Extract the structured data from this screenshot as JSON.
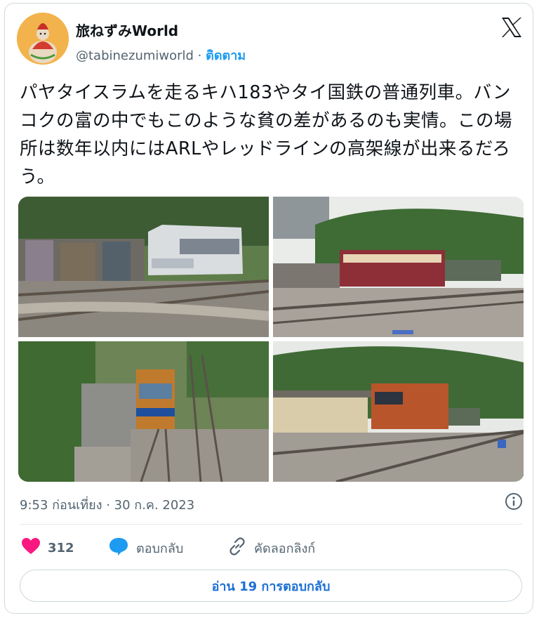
{
  "user": {
    "display_name": "旅ねずみWorld",
    "handle": "@tabinezumiworld",
    "separator": " · ",
    "follow_label": "ติดตาม"
  },
  "tweet": {
    "text": "パヤタイスラムを走るキハ183やタイ国鉄の普通列車。バンコクの富の中でもこのような貧の差があるのも実情。この場所は数年以内にはARLやレッドラインの高架線が出来るだろう。"
  },
  "footer": {
    "timestamp": "9:53 ก่อนเที่ยง · 30 ก.ค. 2023"
  },
  "actions": {
    "like_count": "312",
    "reply_label": "ตอบกลับ",
    "copy_link_label": "คัดลอกลิงก์"
  },
  "read_replies_label": "อ่าน 19 การตอบกลับ",
  "colors": {
    "accent": "#1d9bf0",
    "like": "#f91880",
    "text": "#0f1419",
    "muted": "#536471",
    "border": "#cfd9de"
  },
  "icons": [
    "x-logo-icon",
    "info-icon",
    "heart-icon",
    "reply-bubble-icon",
    "link-icon"
  ]
}
